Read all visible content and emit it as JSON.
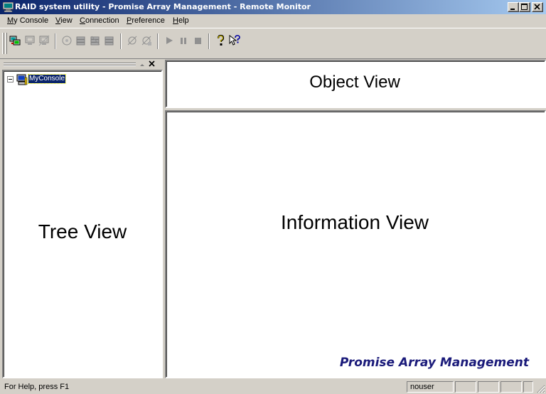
{
  "window": {
    "title": "RAID system utility - Promise Array Management - Remote Monitor"
  },
  "menu": {
    "items": [
      {
        "label": "My Console"
      },
      {
        "label": "View"
      },
      {
        "label": "Connection"
      },
      {
        "label": "Preference"
      },
      {
        "label": "Help"
      }
    ]
  },
  "toolbar": {
    "buttons": [
      {
        "icon": "connect-icon",
        "enabled": true
      },
      {
        "icon": "host-icon",
        "enabled": false
      },
      {
        "icon": "host-disconnect-icon",
        "enabled": false
      },
      {
        "icon": "array-icon",
        "enabled": false
      },
      {
        "icon": "array-create-icon",
        "enabled": false
      },
      {
        "icon": "array-delete-icon",
        "enabled": false
      },
      {
        "icon": "array-properties-icon",
        "enabled": false
      },
      {
        "icon": "sync-icon",
        "enabled": false
      },
      {
        "icon": "rebuild-icon",
        "enabled": false
      },
      {
        "icon": "play-icon",
        "enabled": false
      },
      {
        "icon": "pause-icon",
        "enabled": false
      },
      {
        "icon": "stop-icon",
        "enabled": false
      },
      {
        "icon": "help-icon",
        "enabled": true
      },
      {
        "icon": "context-help-icon",
        "enabled": true
      }
    ]
  },
  "tree": {
    "root_label": "MyConsole",
    "placeholder": "Tree View"
  },
  "object_view": {
    "placeholder": "Object View"
  },
  "information_view": {
    "placeholder": "Information View",
    "brand": "Promise Array Management"
  },
  "statusbar": {
    "help_text": "For Help, press F1",
    "user": "nouser"
  },
  "colors": {
    "titlebar_start": "#0a246a",
    "titlebar_end": "#a6caf0",
    "selection": "#0a246a",
    "brand": "#1a1a7a"
  }
}
